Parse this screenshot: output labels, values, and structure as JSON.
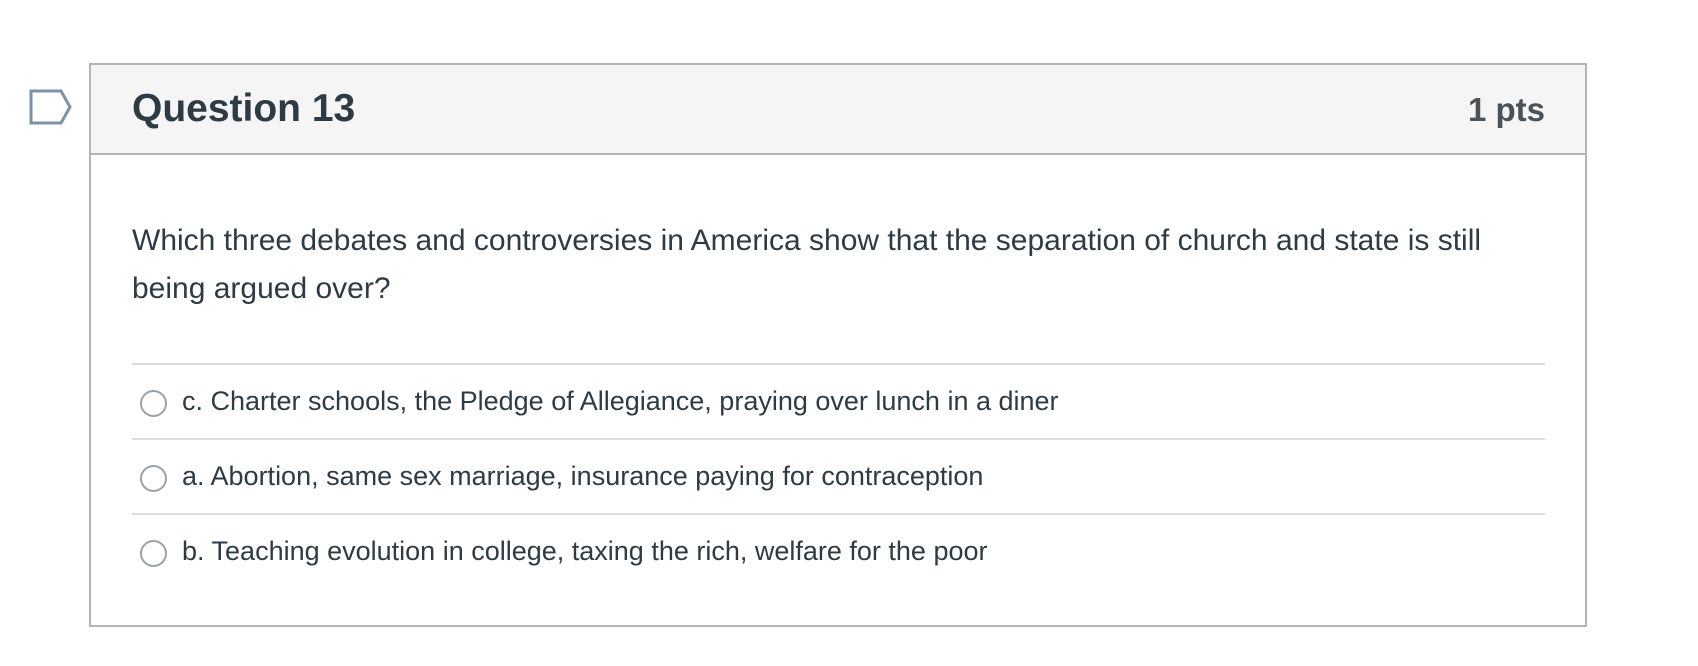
{
  "icons": {
    "flag": "flag-outline-icon",
    "radio": "radio-unchecked-icon"
  },
  "colors": {
    "text": "#2d3b45",
    "header_bg": "#f5f5f5",
    "border": "#b4b4b4",
    "divider": "#dcdcdc",
    "flag_stroke": "#7a93a8"
  },
  "question": {
    "title": "Question 13",
    "points": "1 pts",
    "text": "Which three debates and controversies in America show that the separation of church and state is still being argued over?",
    "answers": [
      {
        "label": "c. Charter schools, the Pledge of Allegiance, praying over lunch in a diner",
        "selected": false
      },
      {
        "label": "a. Abortion, same sex marriage, insurance paying for contraception",
        "selected": false
      },
      {
        "label": "b. Teaching evolution in college, taxing the rich, welfare for the poor",
        "selected": false
      }
    ]
  }
}
